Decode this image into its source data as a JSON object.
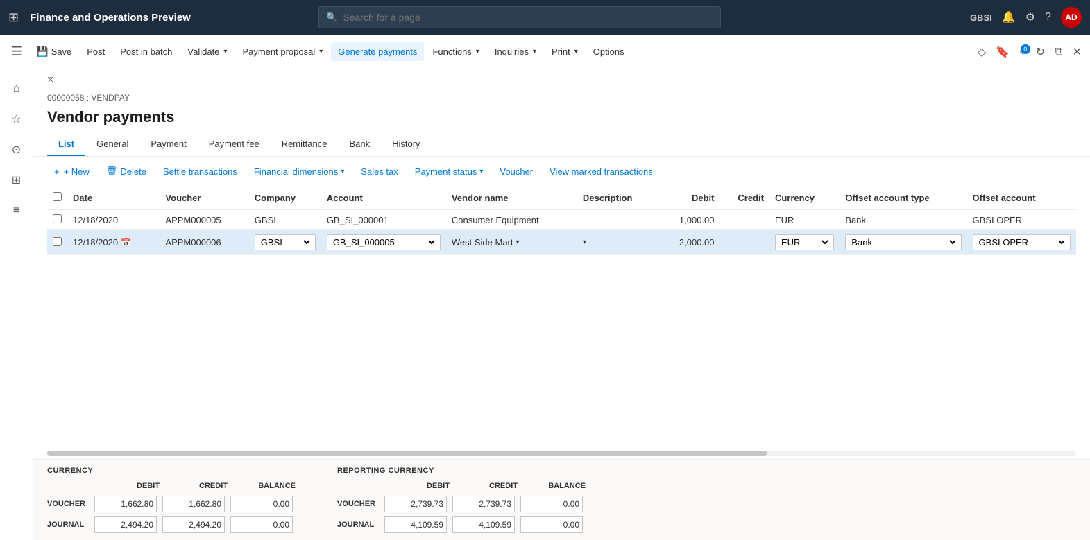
{
  "app": {
    "title": "Finance and Operations Preview",
    "search_placeholder": "Search for a page",
    "user_code": "GBSI",
    "avatar_initials": "AD"
  },
  "action_bar": {
    "menu_toggle": "☰",
    "buttons": [
      {
        "id": "save",
        "icon": "💾",
        "label": "Save",
        "has_arrow": false
      },
      {
        "id": "post",
        "icon": "",
        "label": "Post",
        "has_arrow": false
      },
      {
        "id": "post-in-batch",
        "icon": "",
        "label": "Post in batch",
        "has_arrow": false
      },
      {
        "id": "validate",
        "icon": "",
        "label": "Validate",
        "has_arrow": true
      },
      {
        "id": "payment-proposal",
        "icon": "",
        "label": "Payment proposal",
        "has_arrow": true
      },
      {
        "id": "generate-payments",
        "icon": "",
        "label": "Generate payments",
        "has_arrow": false,
        "active": true
      },
      {
        "id": "functions",
        "icon": "",
        "label": "Functions",
        "has_arrow": true
      },
      {
        "id": "inquiries",
        "icon": "",
        "label": "Inquiries",
        "has_arrow": true
      },
      {
        "id": "print",
        "icon": "",
        "label": "Print",
        "has_arrow": true
      },
      {
        "id": "options",
        "icon": "",
        "label": "Options",
        "has_arrow": false
      }
    ]
  },
  "breadcrumb": "00000058 : VENDPAY",
  "page_title": "Vendor payments",
  "tabs": [
    {
      "id": "list",
      "label": "List",
      "active": true
    },
    {
      "id": "general",
      "label": "General"
    },
    {
      "id": "payment",
      "label": "Payment"
    },
    {
      "id": "payment-fee",
      "label": "Payment fee"
    },
    {
      "id": "remittance",
      "label": "Remittance"
    },
    {
      "id": "bank",
      "label": "Bank"
    },
    {
      "id": "history",
      "label": "History"
    }
  ],
  "toolbar": {
    "new_label": "+ New",
    "delete_label": "🗑 Delete",
    "settle_label": "Settle transactions",
    "financial_label": "Financial dimensions",
    "sales_tax_label": "Sales tax",
    "payment_status_label": "Payment status",
    "voucher_label": "Voucher",
    "view_marked_label": "View marked transactions"
  },
  "table": {
    "columns": [
      {
        "id": "check",
        "label": ""
      },
      {
        "id": "date",
        "label": "Date"
      },
      {
        "id": "voucher",
        "label": "Voucher"
      },
      {
        "id": "company",
        "label": "Company"
      },
      {
        "id": "account",
        "label": "Account"
      },
      {
        "id": "vendor-name",
        "label": "Vendor name"
      },
      {
        "id": "description",
        "label": "Description"
      },
      {
        "id": "debit",
        "label": "Debit",
        "align": "right"
      },
      {
        "id": "credit",
        "label": "Credit",
        "align": "right"
      },
      {
        "id": "currency",
        "label": "Currency"
      },
      {
        "id": "offset-account-type",
        "label": "Offset account type"
      },
      {
        "id": "offset-account",
        "label": "Offset account"
      }
    ],
    "rows": [
      {
        "id": "row1",
        "selected": false,
        "date": "12/18/2020",
        "voucher": "APPM000005",
        "company": "GBSI",
        "account": "GB_SI_000001",
        "vendor_name": "Consumer Equipment",
        "description": "",
        "debit": "1,000.00",
        "credit": "",
        "currency": "EUR",
        "offset_account_type": "Bank",
        "offset_account": "GBSI OPER"
      },
      {
        "id": "row2",
        "selected": true,
        "date": "12/18/2020",
        "voucher": "APPM000006",
        "company": "GBSI",
        "account": "GB_SI_000005",
        "vendor_name": "West Side Mart",
        "description": "",
        "debit": "2,000.00",
        "credit": "",
        "currency": "EUR",
        "offset_account_type": "Bank",
        "offset_account": "GBSI OPER"
      }
    ]
  },
  "summary": {
    "currency_title": "CURRENCY",
    "reporting_title": "REPORTING CURRENCY",
    "headers": [
      "DEBIT",
      "CREDIT",
      "BALANCE"
    ],
    "rows": [
      {
        "label": "VOUCHER",
        "currency_debit": "1,662.80",
        "currency_credit": "1,662.80",
        "currency_balance": "0.00",
        "reporting_debit": "2,739.73",
        "reporting_credit": "2,739.73",
        "reporting_balance": "0.00"
      },
      {
        "label": "JOURNAL",
        "currency_debit": "2,494.20",
        "currency_credit": "2,494.20",
        "currency_balance": "0.00",
        "reporting_debit": "4,109.59",
        "reporting_credit": "4,109.59",
        "reporting_balance": "0.00"
      }
    ]
  },
  "sidebar_icons": [
    "⊞",
    "☆",
    "⊙",
    "⊟",
    "≡"
  ],
  "right_action_icons": [
    "◇",
    "🔔",
    "⚙",
    "?"
  ]
}
